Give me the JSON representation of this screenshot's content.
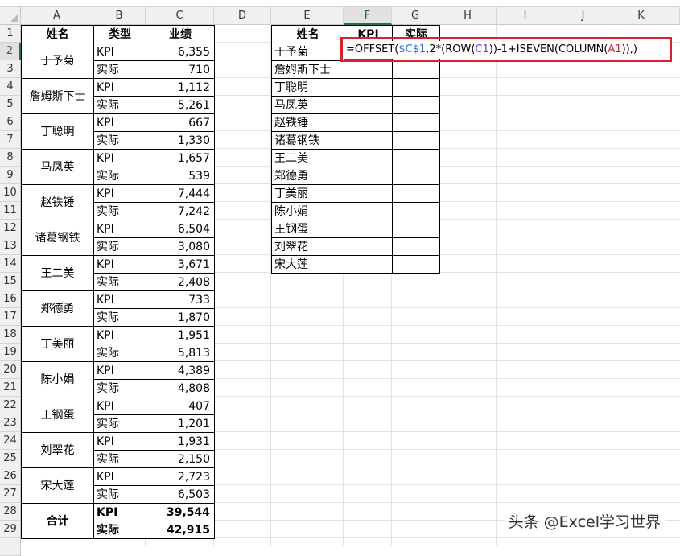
{
  "columns": [
    "A",
    "B",
    "C",
    "D",
    "E",
    "F",
    "G",
    "H",
    "I",
    "J",
    "K"
  ],
  "rows": [
    "1",
    "2",
    "3",
    "4",
    "5",
    "6",
    "7",
    "8",
    "9",
    "10",
    "11",
    "12",
    "13",
    "14",
    "15",
    "16",
    "17",
    "18",
    "19",
    "20",
    "21",
    "22",
    "23",
    "24",
    "25",
    "26",
    "27",
    "28",
    "29"
  ],
  "left_table": {
    "headers": [
      "姓名",
      "类型",
      "业绩"
    ],
    "people": [
      {
        "name": "于予菊",
        "kpi": "6,355",
        "actual": "710"
      },
      {
        "name": "詹姆斯下士",
        "kpi": "1,112",
        "actual": "5,261"
      },
      {
        "name": "丁聪明",
        "kpi": "667",
        "actual": "1,330"
      },
      {
        "name": "马凤英",
        "kpi": "1,657",
        "actual": "539"
      },
      {
        "name": "赵铁锤",
        "kpi": "7,444",
        "actual": "7,242"
      },
      {
        "name": "诸葛钢铁",
        "kpi": "6,504",
        "actual": "3,080"
      },
      {
        "name": "王二美",
        "kpi": "3,671",
        "actual": "2,408"
      },
      {
        "name": "郑德勇",
        "kpi": "733",
        "actual": "1,870"
      },
      {
        "name": "丁美丽",
        "kpi": "1,951",
        "actual": "5,813"
      },
      {
        "name": "陈小娟",
        "kpi": "4,389",
        "actual": "4,808"
      },
      {
        "name": "王钢蛋",
        "kpi": "407",
        "actual": "1,201"
      },
      {
        "name": "刘翠花",
        "kpi": "1,931",
        "actual": "2,150"
      },
      {
        "name": "宋大莲",
        "kpi": "2,723",
        "actual": "6,503"
      }
    ],
    "type_kpi": "KPI",
    "type_actual": "实际",
    "total_label": "合计",
    "total_kpi": "39,544",
    "total_actual": "42,915"
  },
  "right_table": {
    "headers": [
      "姓名",
      "KPI",
      "实际"
    ],
    "names": [
      "于予菊",
      "詹姆斯下士",
      "丁聪明",
      "马凤英",
      "赵铁锤",
      "诸葛钢铁",
      "王二美",
      "郑德勇",
      "丁美丽",
      "陈小娟",
      "王钢蛋",
      "刘翠花",
      "宋大莲"
    ]
  },
  "formula": {
    "p1": "=OFFSET(",
    "ref1": "$C$1",
    "p2": ",2*(ROW(",
    "ref2": "C1",
    "p3": "))-1+ISEVEN(COLUMN(",
    "ref3": "A1",
    "p4": ")),)"
  },
  "watermark": "头条 @Excel学习世界",
  "colors": {
    "header_fill": "#9bc2e6",
    "highlight": "#d9212d",
    "selection": "#217346"
  }
}
